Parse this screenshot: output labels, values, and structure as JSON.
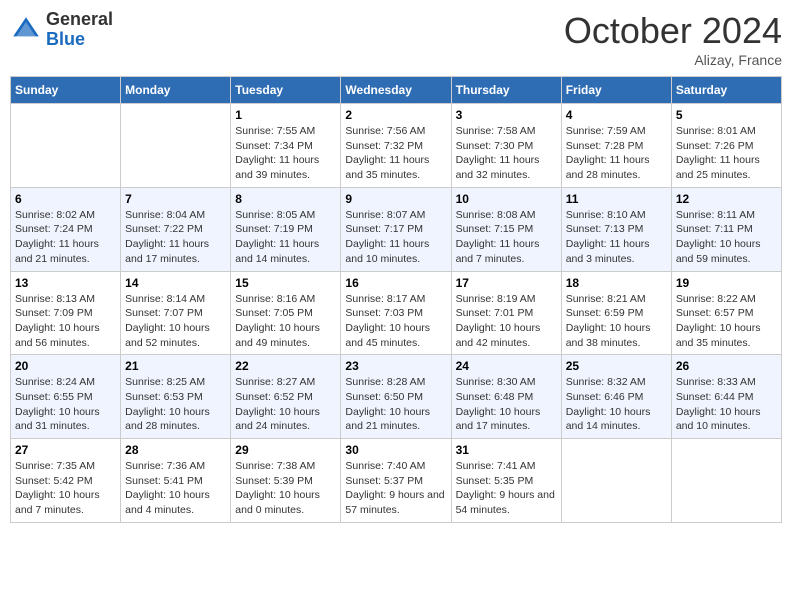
{
  "header": {
    "logo_general": "General",
    "logo_blue": "Blue",
    "month_title": "October 2024",
    "location": "Alizay, France"
  },
  "days_of_week": [
    "Sunday",
    "Monday",
    "Tuesday",
    "Wednesday",
    "Thursday",
    "Friday",
    "Saturday"
  ],
  "weeks": [
    [
      {
        "day": "",
        "info": ""
      },
      {
        "day": "",
        "info": ""
      },
      {
        "day": "1",
        "info": "Sunrise: 7:55 AM\nSunset: 7:34 PM\nDaylight: 11 hours and 39 minutes."
      },
      {
        "day": "2",
        "info": "Sunrise: 7:56 AM\nSunset: 7:32 PM\nDaylight: 11 hours and 35 minutes."
      },
      {
        "day": "3",
        "info": "Sunrise: 7:58 AM\nSunset: 7:30 PM\nDaylight: 11 hours and 32 minutes."
      },
      {
        "day": "4",
        "info": "Sunrise: 7:59 AM\nSunset: 7:28 PM\nDaylight: 11 hours and 28 minutes."
      },
      {
        "day": "5",
        "info": "Sunrise: 8:01 AM\nSunset: 7:26 PM\nDaylight: 11 hours and 25 minutes."
      }
    ],
    [
      {
        "day": "6",
        "info": "Sunrise: 8:02 AM\nSunset: 7:24 PM\nDaylight: 11 hours and 21 minutes."
      },
      {
        "day": "7",
        "info": "Sunrise: 8:04 AM\nSunset: 7:22 PM\nDaylight: 11 hours and 17 minutes."
      },
      {
        "day": "8",
        "info": "Sunrise: 8:05 AM\nSunset: 7:19 PM\nDaylight: 11 hours and 14 minutes."
      },
      {
        "day": "9",
        "info": "Sunrise: 8:07 AM\nSunset: 7:17 PM\nDaylight: 11 hours and 10 minutes."
      },
      {
        "day": "10",
        "info": "Sunrise: 8:08 AM\nSunset: 7:15 PM\nDaylight: 11 hours and 7 minutes."
      },
      {
        "day": "11",
        "info": "Sunrise: 8:10 AM\nSunset: 7:13 PM\nDaylight: 11 hours and 3 minutes."
      },
      {
        "day": "12",
        "info": "Sunrise: 8:11 AM\nSunset: 7:11 PM\nDaylight: 10 hours and 59 minutes."
      }
    ],
    [
      {
        "day": "13",
        "info": "Sunrise: 8:13 AM\nSunset: 7:09 PM\nDaylight: 10 hours and 56 minutes."
      },
      {
        "day": "14",
        "info": "Sunrise: 8:14 AM\nSunset: 7:07 PM\nDaylight: 10 hours and 52 minutes."
      },
      {
        "day": "15",
        "info": "Sunrise: 8:16 AM\nSunset: 7:05 PM\nDaylight: 10 hours and 49 minutes."
      },
      {
        "day": "16",
        "info": "Sunrise: 8:17 AM\nSunset: 7:03 PM\nDaylight: 10 hours and 45 minutes."
      },
      {
        "day": "17",
        "info": "Sunrise: 8:19 AM\nSunset: 7:01 PM\nDaylight: 10 hours and 42 minutes."
      },
      {
        "day": "18",
        "info": "Sunrise: 8:21 AM\nSunset: 6:59 PM\nDaylight: 10 hours and 38 minutes."
      },
      {
        "day": "19",
        "info": "Sunrise: 8:22 AM\nSunset: 6:57 PM\nDaylight: 10 hours and 35 minutes."
      }
    ],
    [
      {
        "day": "20",
        "info": "Sunrise: 8:24 AM\nSunset: 6:55 PM\nDaylight: 10 hours and 31 minutes."
      },
      {
        "day": "21",
        "info": "Sunrise: 8:25 AM\nSunset: 6:53 PM\nDaylight: 10 hours and 28 minutes."
      },
      {
        "day": "22",
        "info": "Sunrise: 8:27 AM\nSunset: 6:52 PM\nDaylight: 10 hours and 24 minutes."
      },
      {
        "day": "23",
        "info": "Sunrise: 8:28 AM\nSunset: 6:50 PM\nDaylight: 10 hours and 21 minutes."
      },
      {
        "day": "24",
        "info": "Sunrise: 8:30 AM\nSunset: 6:48 PM\nDaylight: 10 hours and 17 minutes."
      },
      {
        "day": "25",
        "info": "Sunrise: 8:32 AM\nSunset: 6:46 PM\nDaylight: 10 hours and 14 minutes."
      },
      {
        "day": "26",
        "info": "Sunrise: 8:33 AM\nSunset: 6:44 PM\nDaylight: 10 hours and 10 minutes."
      }
    ],
    [
      {
        "day": "27",
        "info": "Sunrise: 7:35 AM\nSunset: 5:42 PM\nDaylight: 10 hours and 7 minutes."
      },
      {
        "day": "28",
        "info": "Sunrise: 7:36 AM\nSunset: 5:41 PM\nDaylight: 10 hours and 4 minutes."
      },
      {
        "day": "29",
        "info": "Sunrise: 7:38 AM\nSunset: 5:39 PM\nDaylight: 10 hours and 0 minutes."
      },
      {
        "day": "30",
        "info": "Sunrise: 7:40 AM\nSunset: 5:37 PM\nDaylight: 9 hours and 57 minutes."
      },
      {
        "day": "31",
        "info": "Sunrise: 7:41 AM\nSunset: 5:35 PM\nDaylight: 9 hours and 54 minutes."
      },
      {
        "day": "",
        "info": ""
      },
      {
        "day": "",
        "info": ""
      }
    ]
  ]
}
